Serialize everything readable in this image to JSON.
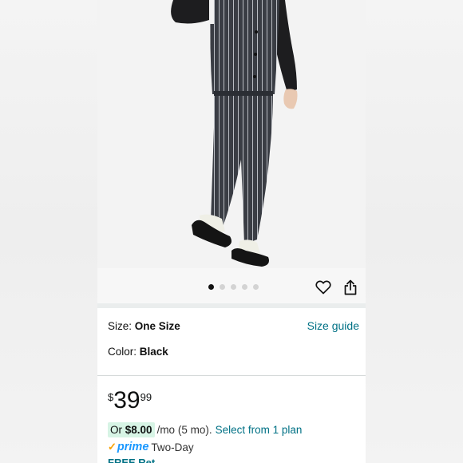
{
  "product": {
    "image_dots": 5,
    "active_dot": 0
  },
  "options": {
    "size_label": "Size:",
    "size_value": "One Size",
    "size_guide": "Size guide",
    "color_label": "Color:",
    "color_value": "Black"
  },
  "price": {
    "symbol": "$",
    "whole": "39",
    "fraction": "99"
  },
  "installment": {
    "or_prefix": "Or",
    "amount": "$8.00",
    "period": "/mo (5 mo).",
    "link": "Select from 1 plan"
  },
  "shipping": {
    "prime_label": "prime",
    "prime_text": "Two-Day",
    "free_text": "FREE Ret"
  },
  "colors": {
    "link": "#007185",
    "prime_blue": "#1a98ff",
    "installment_badge": "#d7f4e5"
  },
  "icons": [
    "heart-icon",
    "share-icon",
    "prime-check-icon"
  ]
}
